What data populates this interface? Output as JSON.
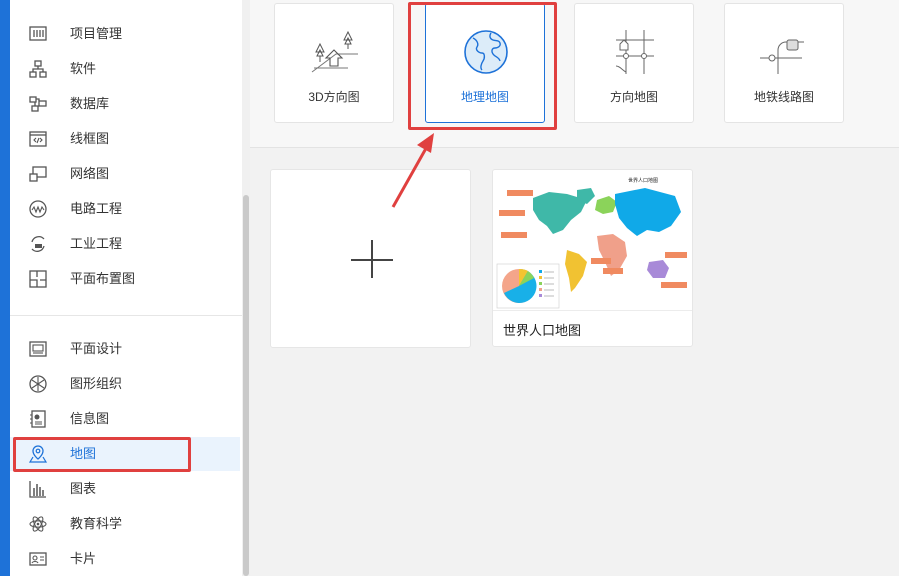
{
  "sidebar": {
    "items": [
      {
        "label": "项目管理",
        "icon": "project-management-icon"
      },
      {
        "label": "软件",
        "icon": "software-icon"
      },
      {
        "label": "数据库",
        "icon": "database-icon"
      },
      {
        "label": "线框图",
        "icon": "wireframe-icon"
      },
      {
        "label": "网络图",
        "icon": "network-icon"
      },
      {
        "label": "电路工程",
        "icon": "circuit-icon"
      },
      {
        "label": "工业工程",
        "icon": "industrial-icon"
      },
      {
        "label": "平面布置图",
        "icon": "floor-plan-icon"
      },
      {
        "label": "平面设计",
        "icon": "graphic-design-icon"
      },
      {
        "label": "图形组织",
        "icon": "graphic-organizer-icon"
      },
      {
        "label": "信息图",
        "icon": "infographic-icon"
      },
      {
        "label": "地图",
        "icon": "map-pin-icon"
      },
      {
        "label": "图表",
        "icon": "bar-chart-icon"
      },
      {
        "label": "教育科学",
        "icon": "atom-icon"
      },
      {
        "label": "卡片",
        "icon": "card-icon"
      }
    ],
    "active_label": "地图"
  },
  "map_types": [
    {
      "label": "3D方向图",
      "icon": "3d-direction-map-icon"
    },
    {
      "label": "地理地图",
      "icon": "globe-icon"
    },
    {
      "label": "方向地图",
      "icon": "direction-map-icon"
    },
    {
      "label": "地铁线路图",
      "icon": "subway-map-icon"
    }
  ],
  "selected_map_type": "地理地图",
  "templates": {
    "new_template_icon": "plus-icon",
    "world_map": {
      "title": "世界人口地图",
      "thumb_heading": "世界人口地图"
    }
  },
  "colors": {
    "accent": "#1e72d8",
    "highlight": "#e0403f"
  }
}
